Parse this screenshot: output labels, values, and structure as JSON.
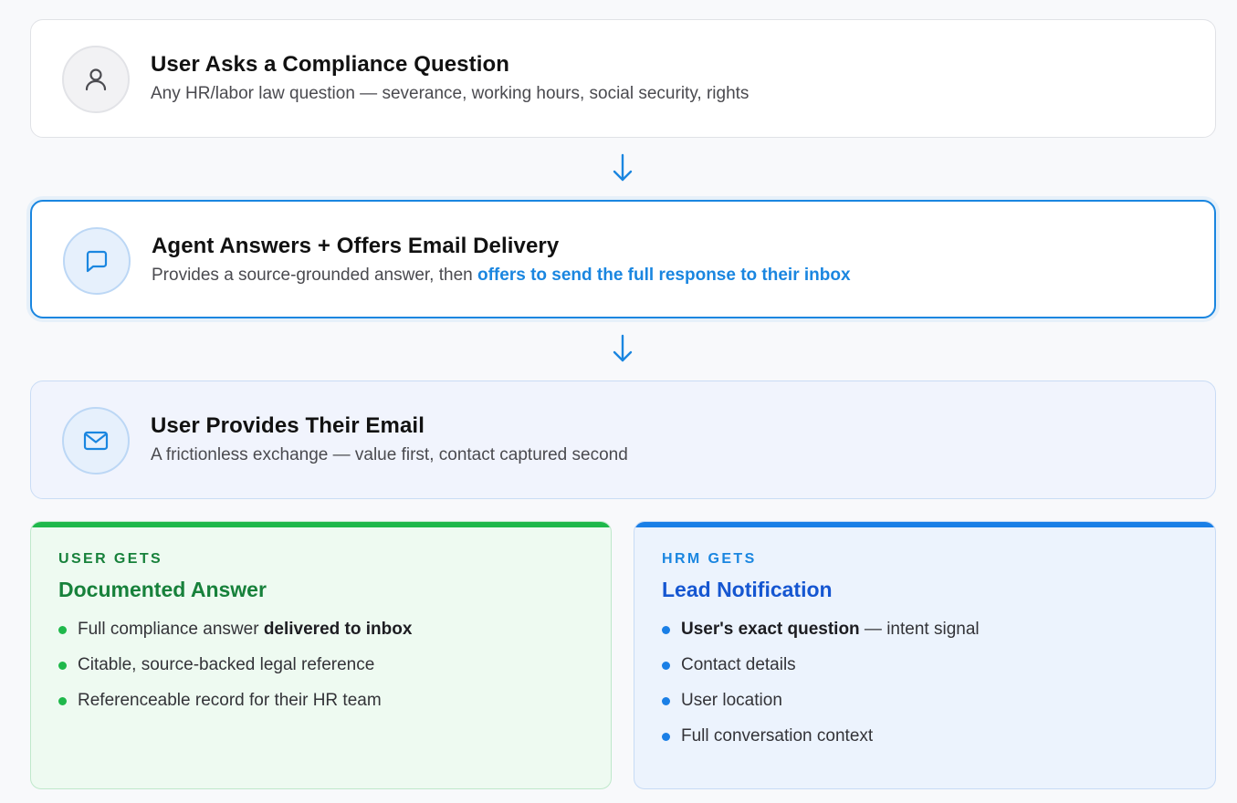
{
  "steps": [
    {
      "title": "User Asks a Compliance Question",
      "desc": "Any HR/labor law question — severance, working hours, social security, rights",
      "icon": "user-icon"
    },
    {
      "title": "Agent Answers + Offers Email Delivery",
      "desc_prefix": "Provides a source-grounded answer, then ",
      "desc_highlight": "offers to send the full response to their inbox",
      "icon": "chat-bubble-icon"
    },
    {
      "title": "User Provides Their Email",
      "desc": "A frictionless exchange — value first, contact captured second",
      "icon": "envelope-icon"
    }
  ],
  "outcomes": {
    "user": {
      "eyebrow": "USER GETS",
      "title": "Documented Answer",
      "items": [
        {
          "text": "Full compliance answer ",
          "bold": "delivered to inbox",
          "suffix": ""
        },
        {
          "text": "Citable, source-backed legal reference",
          "bold": "",
          "suffix": ""
        },
        {
          "text": "Referenceable record for their HR team",
          "bold": "",
          "suffix": ""
        }
      ]
    },
    "hrm": {
      "eyebrow": "HRM GETS",
      "title": "Lead Notification",
      "items": [
        {
          "text": "",
          "bold": "User's exact question",
          "suffix": " — intent signal"
        },
        {
          "text": "Contact details",
          "bold": "",
          "suffix": ""
        },
        {
          "text": "User location",
          "bold": "",
          "suffix": ""
        },
        {
          "text": "Full conversation context",
          "bold": "",
          "suffix": ""
        }
      ]
    }
  },
  "colors": {
    "accent_blue": "#1a86e0",
    "accent_green": "#1fb84b",
    "hrm_title_blue": "#1556d1",
    "user_title_green": "#17813b"
  }
}
